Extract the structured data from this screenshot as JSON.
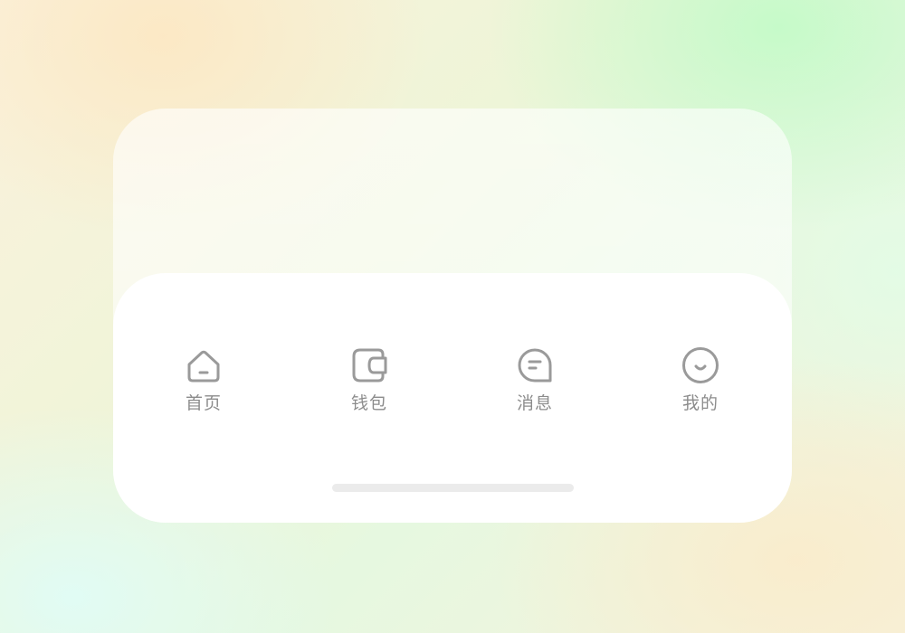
{
  "tabbar": {
    "tabs": [
      {
        "id": "home",
        "label": "首页",
        "icon": "home-icon"
      },
      {
        "id": "wallet",
        "label": "钱包",
        "icon": "wallet-icon"
      },
      {
        "id": "messages",
        "label": "消息",
        "icon": "message-icon"
      },
      {
        "id": "profile",
        "label": "我的",
        "icon": "smile-icon"
      }
    ]
  },
  "colors": {
    "icon": "#9a9a9a",
    "label": "#8c8c8c",
    "tabbar_background": "#ffffff",
    "home_indicator": "#ebebeb"
  }
}
